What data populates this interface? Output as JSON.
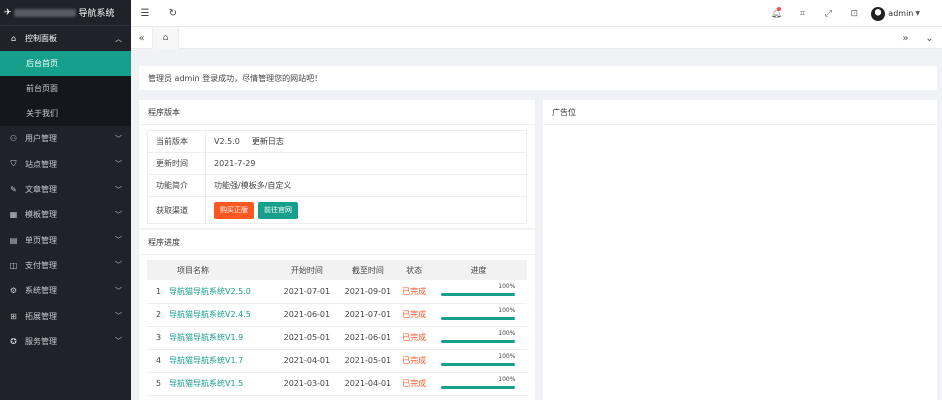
{
  "logo": {
    "title": "导航系统"
  },
  "sidebar": {
    "groups": [
      {
        "label": "控制面板",
        "icon": "home-icon",
        "open": true,
        "children": [
          {
            "label": "后台首页",
            "active": true
          },
          {
            "label": "前台页面",
            "active": false
          },
          {
            "label": "关于我们",
            "active": false
          }
        ]
      },
      {
        "label": "用户管理",
        "icon": "user-icon"
      },
      {
        "label": "站点管理",
        "icon": "shield-icon"
      },
      {
        "label": "文章管理",
        "icon": "doc-icon"
      },
      {
        "label": "模板管理",
        "icon": "template-icon"
      },
      {
        "label": "单页管理",
        "icon": "page-icon"
      },
      {
        "label": "支付管理",
        "icon": "pay-icon"
      },
      {
        "label": "系统管理",
        "icon": "gear-icon"
      },
      {
        "label": "拓展管理",
        "icon": "extend-icon"
      },
      {
        "label": "服务管理",
        "icon": "service-icon"
      }
    ]
  },
  "header": {
    "username": "admin"
  },
  "notice": "管理员 admin 登录成功，尽情管理您的网站吧！",
  "version_card": {
    "title": "程序版本",
    "rows": [
      {
        "label": "当前版本",
        "value": "V2.5.0",
        "link": "更新日志"
      },
      {
        "label": "更新时间",
        "value": "2021-7-29"
      },
      {
        "label": "功能简介",
        "value": "功能强/模板多/自定义"
      },
      {
        "label": "获取渠道",
        "buttons": [
          "购买正版",
          "前往官网"
        ]
      }
    ]
  },
  "ad_card": {
    "title": "广告位"
  },
  "progress_card": {
    "title": "程序进度",
    "columns": [
      "项目名称",
      "开始时间",
      "截至时间",
      "状态",
      "进度"
    ],
    "rows": [
      {
        "num": "1",
        "name": "导航猫导航系统V2.5.0",
        "start": "2021-07-01",
        "end": "2021-09-01",
        "status": "已完成",
        "progress": "100%",
        "fraction": 1.0
      },
      {
        "num": "2",
        "name": "导航猫导航系统V2.4.5",
        "start": "2021-06-01",
        "end": "2021-07-01",
        "status": "已完成",
        "progress": "100%",
        "fraction": 1.0
      },
      {
        "num": "3",
        "name": "导航猫导航系统V1.9",
        "start": "2021-05-01",
        "end": "2021-06-01",
        "status": "已完成",
        "progress": "100%",
        "fraction": 1.0
      },
      {
        "num": "4",
        "name": "导航猫导航系统V1.7",
        "start": "2021-04-01",
        "end": "2021-05-01",
        "status": "已完成",
        "progress": "100%",
        "fraction": 1.0
      },
      {
        "num": "5",
        "name": "导航猫导航系统V1.5",
        "start": "2021-03-01",
        "end": "2021-04-01",
        "status": "已完成",
        "progress": "100%",
        "fraction": 1.0
      }
    ]
  },
  "colors": {
    "accent": "#16a08c",
    "orange": "#ff5722",
    "sidebar": "#20222a"
  }
}
